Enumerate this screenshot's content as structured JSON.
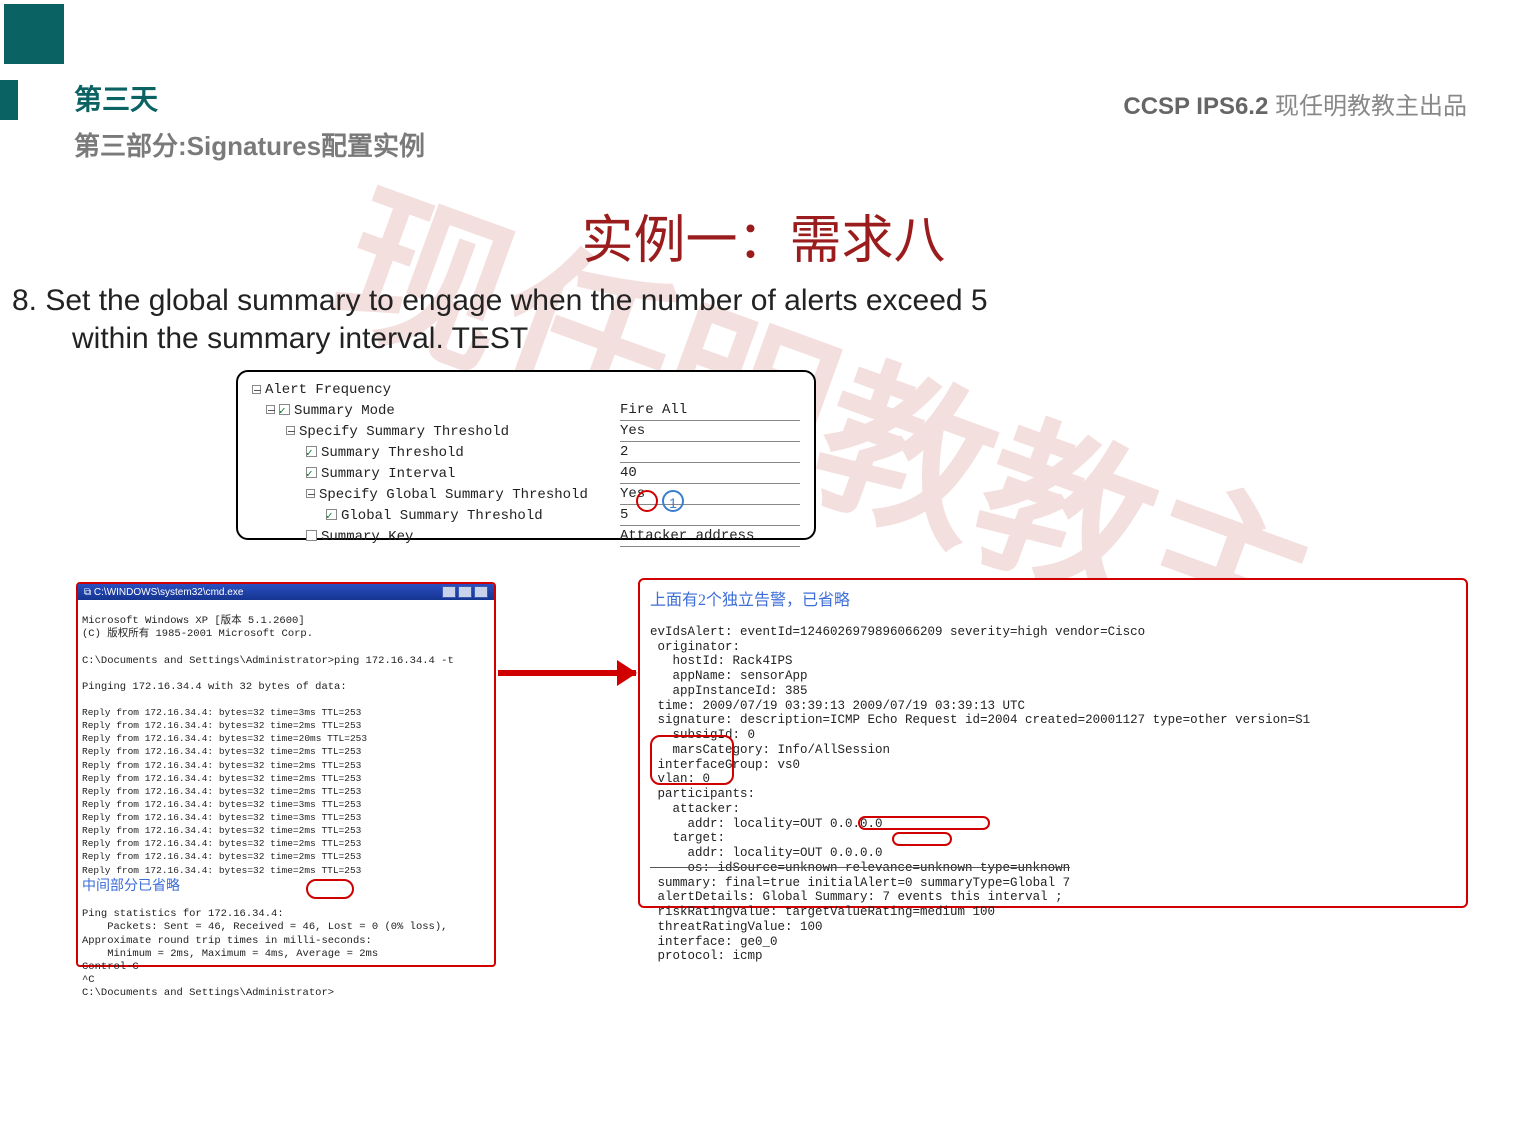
{
  "header": {
    "day": "第三天",
    "part": "第三部分:Signatures配置实例",
    "course_code": "CCSP IPS6.2",
    "course_tail": " 现任明教教主出品"
  },
  "watermark": "现任明教教主",
  "title": "实例一：需求八",
  "requirement": {
    "line1": "8. Set the global summary to engage when the number of alerts exceed 5",
    "line2": "within the summary interval. TEST"
  },
  "tree": {
    "r0": {
      "l": "Alert Frequency",
      "v": ""
    },
    "r1": {
      "l": "Summary Mode",
      "v": "Fire All"
    },
    "r2": {
      "l": "Specify Summary Threshold",
      "v": "Yes"
    },
    "r3": {
      "l": "Summary Threshold",
      "v": "2"
    },
    "r4": {
      "l": "Summary Interval",
      "v": "40"
    },
    "r5": {
      "l": "Specify Global Summary Threshold",
      "v": "Yes"
    },
    "r6": {
      "l": "Global Summary Threshold",
      "v": "5"
    },
    "r7": {
      "l": "Summary Key",
      "v": "Attacker address"
    }
  },
  "annot1_num": "1",
  "cmd": {
    "title": "C:\\WINDOWS\\system32\\cmd.exe",
    "l1": "Microsoft Windows XP [版本 5.1.2600]",
    "l2": "(C) 版权所有 1985-2001 Microsoft Corp.",
    "l3": "C:\\Documents and Settings\\Administrator>ping 172.16.34.4 -t",
    "l4": "Pinging 172.16.34.4 with 32 bytes of data:",
    "rep1": "Reply from 172.16.34.4: bytes=32 time=3ms TTL=253",
    "rep2": "Reply from 172.16.34.4: bytes=32 time=2ms TTL=253",
    "rep3": "Reply from 172.16.34.4: bytes=32 time=20ms TTL=253",
    "rep4": "Reply from 172.16.34.4: bytes=32 time=2ms TTL=253",
    "rep5": "Reply from 172.16.34.4: bytes=32 time=2ms TTL=253",
    "rep6": "Reply from 172.16.34.4: bytes=32 time=2ms TTL=253",
    "rep7": "Reply from 172.16.34.4: bytes=32 time=2ms TTL=253",
    "rep8": "Reply from 172.16.34.4: bytes=32 time=3ms TTL=253",
    "rep9": "Reply from 172.16.34.4: bytes=32 time=3ms TTL=253",
    "rep10": "Reply from 172.16.34.4: bytes=32 time=2ms TTL=253",
    "rep11": "Reply from 172.16.34.4: bytes=32 time=2ms TTL=253",
    "rep12": "Reply from 172.16.34.4: bytes=32 time=2ms TTL=253",
    "rep13": "Reply from 172.16.34.4: bytes=32 time=2ms TTL=253",
    "omit": "中间部分已省略",
    "s1": "Ping statistics for 172.16.34.4:",
    "s2": "    Packets: Sent = 46, Received = 46, Lost = 0 (0% loss),",
    "s3": "Approximate round trip times in milli-seconds:",
    "s4": "    Minimum = 2ms, Maximum = 4ms, Average = 2ms",
    "s5": "Control-C",
    "s6": "^C",
    "s7": "C:\\Documents and Settings\\Administrator>"
  },
  "alert": {
    "head": "上面有2个独立告警，已省略",
    "b01": "evIdsAlert: eventId=1246026979896066209 severity=high vendor=Cisco",
    "b02": " originator:",
    "b03": "   hostId: Rack4IPS",
    "b04": "   appName: sensorApp",
    "b05": "   appInstanceId: 385",
    "b06": " time: 2009/07/19 03:39:13 2009/07/19 03:39:13 UTC",
    "b07": " signature: description=ICMP Echo Request id=2004 created=20001127 type=other version=S1",
    "b08": "   subsigId: 0",
    "b09": "   marsCategory: Info/AllSession",
    "b10": " interfaceGroup: vs0",
    "b11": " vlan: 0",
    "b12": " participants:",
    "b13": "   attacker:",
    "b14": "     addr: locality=OUT 0.0.0.0",
    "b15": "   target:",
    "b16": "     addr: locality=OUT 0.0.0.0",
    "b17": "     os: idSource=unknown relevance=unknown type=unknown",
    "b18a": " summary: final=true initialAlert=0 ",
    "b18b": "summaryType=Global 7",
    "b19a": " alertDetails: Global Summary: ",
    "b19b": "7 events",
    "b19c": " this interval ;",
    "b20": " riskRatingValue: targetValueRating=medium 100",
    "b21": " threatRatingValue: 100",
    "b22": " interface: ge0_0",
    "b23": " protocol: icmp"
  }
}
